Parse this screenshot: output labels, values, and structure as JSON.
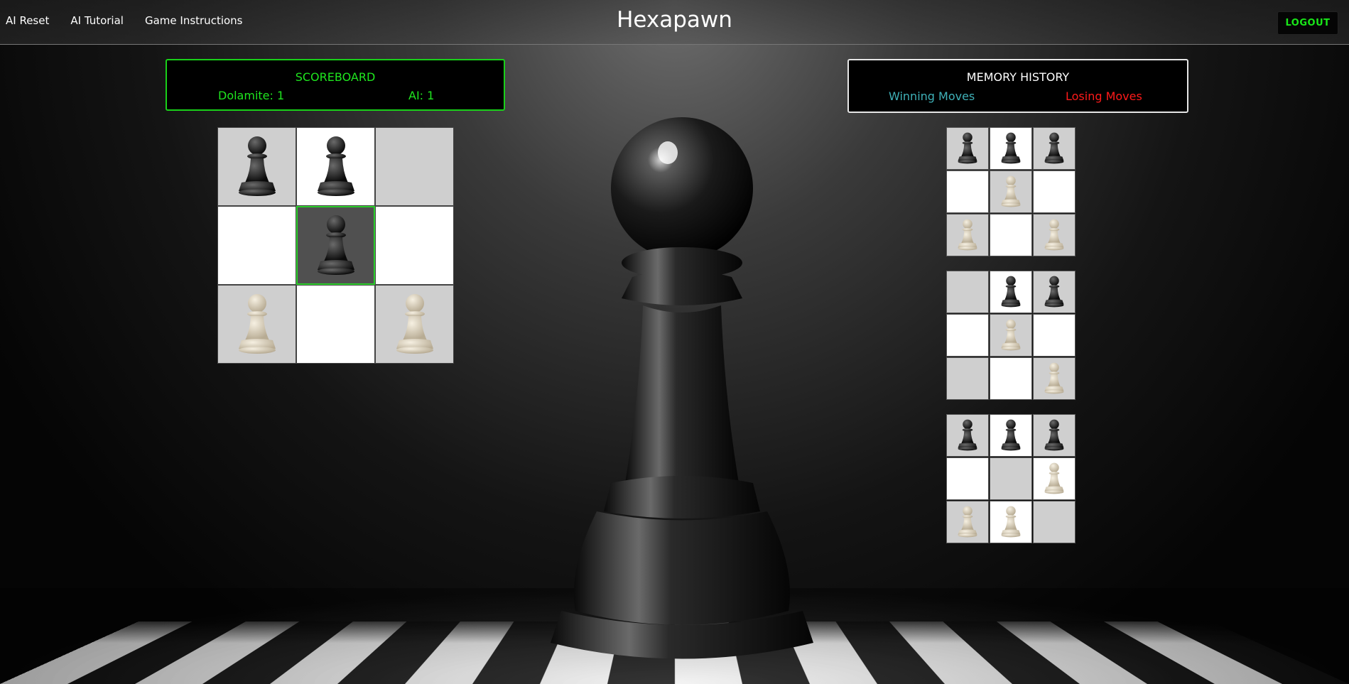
{
  "nav": {
    "links": [
      "AI Reset",
      "AI Tutorial",
      "Game Instructions"
    ],
    "title": "Hexapawn",
    "logout": "LOGOUT"
  },
  "scoreboard": {
    "title": "SCOREBOARD",
    "player": "Dolamite: 1",
    "ai": "AI: 1"
  },
  "memory": {
    "title": "MEMORY HISTORY",
    "winning": "Winning Moves",
    "losing": "Losing Moves"
  },
  "board": {
    "cells": [
      {
        "piece": "black",
        "shade": "gray"
      },
      {
        "piece": "black",
        "shade": "light"
      },
      {
        "piece": "none",
        "shade": "gray"
      },
      {
        "piece": "none",
        "shade": "light"
      },
      {
        "piece": "black",
        "shade": "selected"
      },
      {
        "piece": "none",
        "shade": "light"
      },
      {
        "piece": "white",
        "shade": "gray"
      },
      {
        "piece": "none",
        "shade": "light"
      },
      {
        "piece": "white",
        "shade": "gray"
      }
    ]
  },
  "memory_boards": [
    {
      "cells": [
        {
          "piece": "black",
          "shade": "gray"
        },
        {
          "piece": "black",
          "shade": "light"
        },
        {
          "piece": "black",
          "shade": "gray"
        },
        {
          "piece": "none",
          "shade": "light"
        },
        {
          "piece": "white",
          "shade": "gray"
        },
        {
          "piece": "none",
          "shade": "light"
        },
        {
          "piece": "white",
          "shade": "gray"
        },
        {
          "piece": "none",
          "shade": "light"
        },
        {
          "piece": "white",
          "shade": "gray"
        }
      ]
    },
    {
      "cells": [
        {
          "piece": "none",
          "shade": "gray"
        },
        {
          "piece": "black",
          "shade": "light"
        },
        {
          "piece": "black",
          "shade": "gray"
        },
        {
          "piece": "none",
          "shade": "light"
        },
        {
          "piece": "white",
          "shade": "gray"
        },
        {
          "piece": "none",
          "shade": "light"
        },
        {
          "piece": "none",
          "shade": "gray"
        },
        {
          "piece": "none",
          "shade": "light"
        },
        {
          "piece": "white",
          "shade": "gray"
        }
      ]
    },
    {
      "cells": [
        {
          "piece": "black",
          "shade": "gray"
        },
        {
          "piece": "black",
          "shade": "light"
        },
        {
          "piece": "black",
          "shade": "gray"
        },
        {
          "piece": "none",
          "shade": "light"
        },
        {
          "piece": "none",
          "shade": "gray"
        },
        {
          "piece": "white",
          "shade": "light"
        },
        {
          "piece": "white",
          "shade": "gray"
        },
        {
          "piece": "white",
          "shade": "light"
        },
        {
          "piece": "none",
          "shade": "gray"
        }
      ]
    }
  ],
  "colors": {
    "accent_green": "#1fe61f",
    "winning": "#3fb1b8",
    "losing": "#ff1a1a"
  },
  "icons": {
    "black_piece": "black-pawn-icon",
    "white_piece": "white-pawn-icon",
    "hero": "pawn-hero-icon"
  }
}
